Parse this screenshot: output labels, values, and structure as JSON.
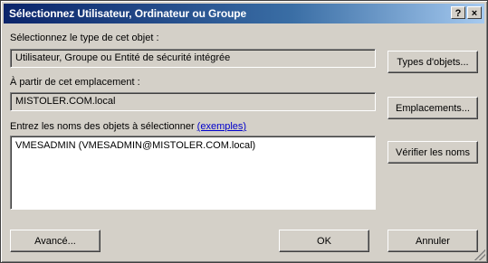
{
  "dialog": {
    "title": "Sélectionnez Utilisateur, Ordinateur ou Groupe",
    "help_label": "?",
    "close_label": "×"
  },
  "object_type": {
    "label": "Sélectionnez le type de cet objet :",
    "value": "Utilisateur, Groupe ou Entité de sécurité intégrée",
    "button": "Types d'objets..."
  },
  "location": {
    "label": "À partir de cet emplacement :",
    "value": "MISTOLER.COM.local",
    "button": "Emplacements..."
  },
  "names": {
    "label": "Entrez les noms des objets à sélectionner",
    "link": "(exemples)",
    "value": "VMESADMIN (VMESADMIN@MISTOLER.COM.local)",
    "check_button": "Vérifier les noms"
  },
  "footer": {
    "advanced_button": "Avancé...",
    "ok_button": "OK",
    "cancel_button": "Annuler"
  }
}
